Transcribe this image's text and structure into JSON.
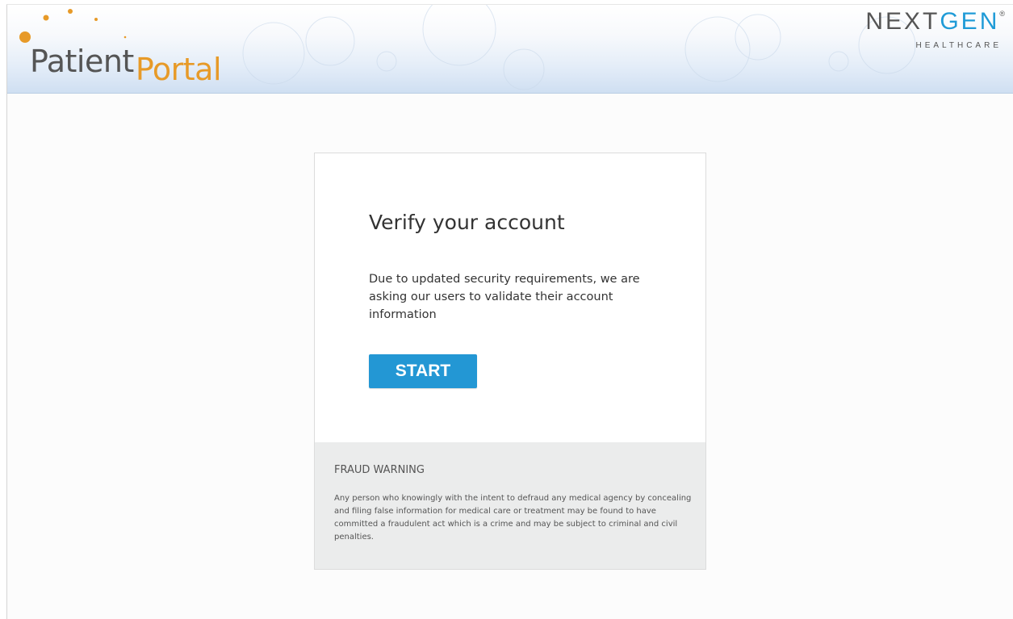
{
  "header": {
    "logo": {
      "part1": "Patient",
      "part2": "Portal",
      "dot_color": "#e79a28",
      "text_color": "#555555"
    },
    "brand": {
      "name_part1": "NEXT",
      "name_part2": "GEN",
      "registered": "®",
      "subtitle": "HEALTHCARE",
      "gen_color": "#1f9bd7"
    }
  },
  "card": {
    "title": "Verify your account",
    "body": "Due to updated security requirements, we are asking our users to validate their account information",
    "start_button": "START",
    "button_color": "#2397d4"
  },
  "fraud": {
    "title": "FRAUD WARNING",
    "text": "Any person who knowingly with the intent to defraud any medical agency by concealing and filing false information for medical care or treatment may be found to have committed a fraudulent act which is a crime and may be subject to criminal and civil penalties."
  }
}
